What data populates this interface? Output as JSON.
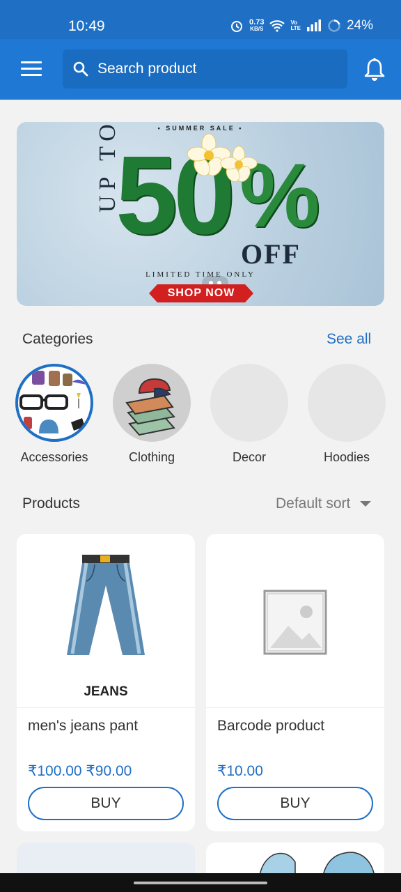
{
  "status_bar": {
    "time": "10:49",
    "net_speed": "0.73",
    "net_unit": "KB/S",
    "volte_top": "Vo",
    "volte_bottom": "LTE",
    "battery": "24%"
  },
  "app_bar": {
    "search_placeholder": "Search product",
    "menu_icon": "hamburger-menu-icon",
    "search_icon": "search-icon",
    "bell_icon": "bell-icon"
  },
  "banner": {
    "top_text": "• SUMMER SALE •",
    "up_to": "UP TO",
    "big_number": "50",
    "percent": "%",
    "off": "OFF",
    "limited": "LIMITED TIME ONLY",
    "cta": "SHOP NOW",
    "slide_count": 2
  },
  "categories": {
    "title": "Categories",
    "see_all": "See all",
    "items": [
      {
        "label": "Accessories",
        "selected": true
      },
      {
        "label": "Clothing",
        "selected": false
      },
      {
        "label": "Decor",
        "selected": false
      },
      {
        "label": "Hoodies",
        "selected": false
      }
    ]
  },
  "products": {
    "title": "Products",
    "sort_label": "Default sort",
    "items": [
      {
        "name": "men's jeans pant",
        "image_caption": "JEANS",
        "price": "₹100.00 ₹90.00",
        "buy": "BUY"
      },
      {
        "name": "Barcode product",
        "image_caption": "",
        "price": "₹10.00",
        "buy": "BUY"
      }
    ]
  },
  "colors": {
    "primary": "#1f78d4",
    "status_bar": "#1f6fc5",
    "accent_text": "#1f6fc5",
    "sale_red": "#d22020"
  }
}
